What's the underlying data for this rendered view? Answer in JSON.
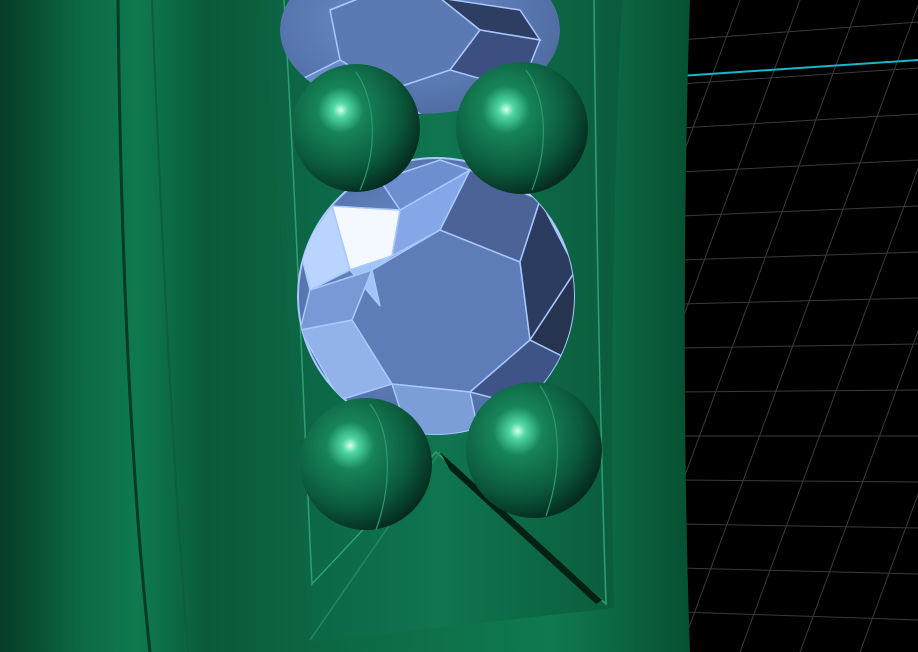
{
  "scene": {
    "background": "#000000",
    "grid_color": "#3a3a3a",
    "axis_color": "#19b6c8",
    "metal_color": "#0e6b45",
    "metal_highlight": "#2fbf86",
    "gem_fill": "#7fa6e6",
    "gem_edge": "#a9c8ff"
  },
  "objects": [
    {
      "name": "ring-shank",
      "kind": "metal"
    },
    {
      "name": "bezel-channel",
      "kind": "metal"
    },
    {
      "name": "upper-gemstone",
      "kind": "gem"
    },
    {
      "name": "lower-gemstone",
      "kind": "gem"
    },
    {
      "name": "prong-bead-1",
      "kind": "bead"
    },
    {
      "name": "prong-bead-2",
      "kind": "bead"
    },
    {
      "name": "prong-bead-3",
      "kind": "bead"
    },
    {
      "name": "prong-bead-4",
      "kind": "bead"
    }
  ]
}
